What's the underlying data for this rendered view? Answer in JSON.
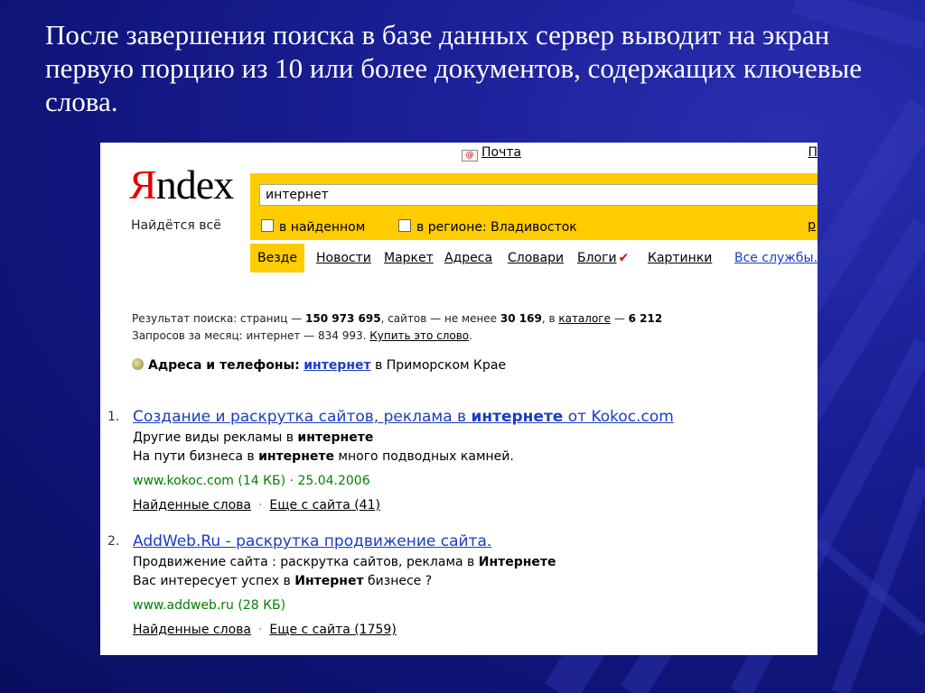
{
  "slide": {
    "title": "После завершения поиска в базе данных сервер выводит на экран первую порцию из 10 или более документов, содержащих ключевые слова."
  },
  "colors": {
    "accent_yellow": "#ffcc00",
    "link_blue": "#1a3dc1",
    "url_green": "#008000",
    "logo_red": "#e10000",
    "background": "#141a8a"
  },
  "header": {
    "mail_label": "Почта",
    "corner_label": "П",
    "logo_first": "Я",
    "logo_rest": "ndex",
    "tagline": "Найдётся всё"
  },
  "search": {
    "query": "интернет",
    "option_found": "в найденном",
    "option_region": "в регионе: Владивосток",
    "right_link": "р"
  },
  "tabs": {
    "everywhere": "Везде",
    "news": "Новости",
    "market": "Маркет",
    "addresses": "Адреса",
    "dictionaries": "Словари",
    "blogs": "Блоги",
    "blogs_mark": "✔",
    "images": "Картинки",
    "all_services": "Все службы."
  },
  "stats": {
    "prefix": "Результат поиска: страниц — ",
    "pages": "150 973 695",
    "sites_text": ", сайтов — не менее ",
    "sites": "30 169",
    "in_text": ", в ",
    "catalog": "каталоге",
    "dash": " — ",
    "catalog_count": "6 212",
    "monthly": "Запросов за месяц: интернет — 834 993. ",
    "buy_link": "Купить это слово",
    "buy_end": "."
  },
  "addr": {
    "label": "Адреса и телефоны:",
    "query": "интернет",
    "rest": " в Приморском Крае"
  },
  "results": [
    {
      "num": "1.",
      "title_pre": "Создание и раскрутка сайтов, реклама в ",
      "title_bold": "интернете",
      "title_post": " от Kokoc.com",
      "line1_pre": "Другие виды рекламы в ",
      "line1_bold": "интернете",
      "line1_post": "",
      "line2_pre": "На пути бизнеса в ",
      "line2_bold": "интернете",
      "line2_post": " много подводных камней.",
      "url": "www.kokoc.com (14 КБ) · 25.04.2006",
      "found_words": "Найденные слова",
      "more_from_site": "Еще с сайта (41)"
    },
    {
      "num": "2.",
      "title_pre": "AddWeb.Ru - раскрутка продвижение сайта.",
      "title_bold": "",
      "title_post": "",
      "line1_pre": "Продвижение сайта : раскрутка сайтов, реклама в ",
      "line1_bold": "Интернете",
      "line1_post": "",
      "line2_pre": "Вас интересует успех в ",
      "line2_bold": "Интернет",
      "line2_post": " бизнесе ?",
      "url": "www.addweb.ru (28 КБ)",
      "found_words": "Найденные слова",
      "more_from_site": "Еще с сайта (1759)"
    }
  ]
}
